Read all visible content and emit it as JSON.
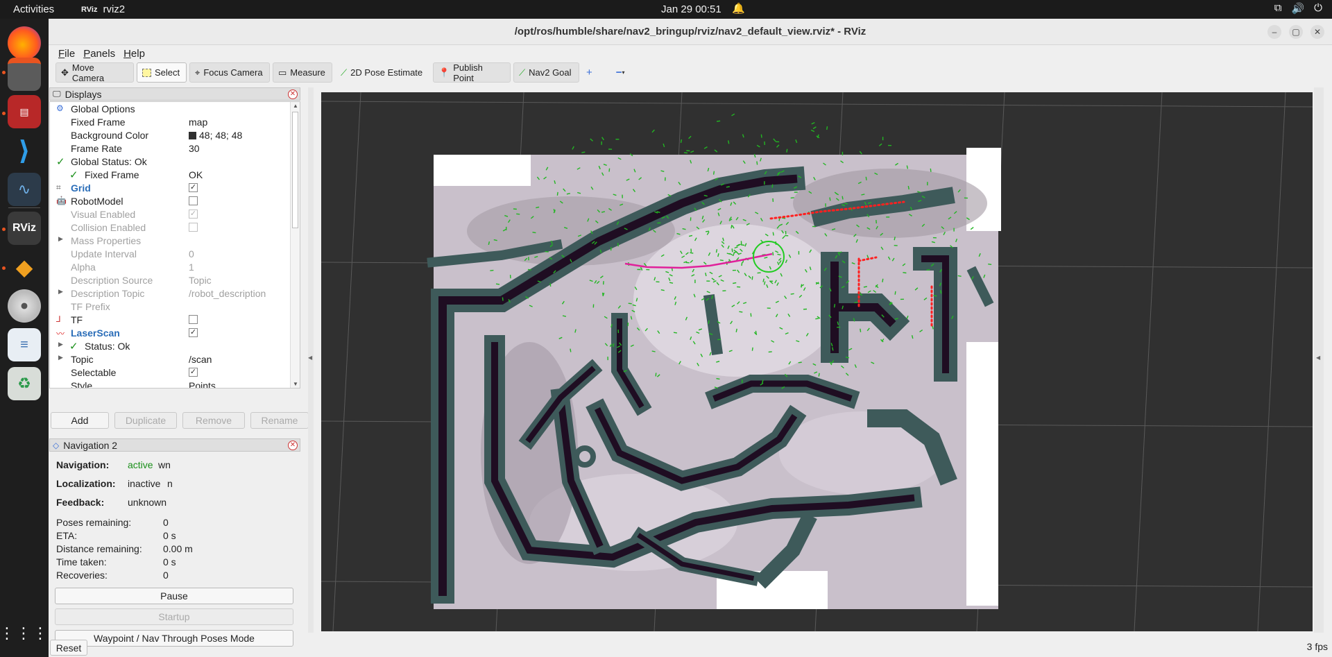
{
  "topbar": {
    "activities": "Activities",
    "app_name": "rviz2",
    "clock": "Jan 29  00:51"
  },
  "dock": {
    "items": [
      {
        "name": "firefox-icon"
      },
      {
        "name": "files-icon"
      },
      {
        "name": "terminal-icon"
      },
      {
        "name": "vscode-icon"
      },
      {
        "name": "system-monitor-icon"
      },
      {
        "name": "rviz-icon"
      },
      {
        "name": "gazebo-icon"
      },
      {
        "name": "disc-icon"
      },
      {
        "name": "text-editor-icon"
      },
      {
        "name": "trash-icon"
      },
      {
        "name": "show-apps-icon"
      }
    ]
  },
  "window": {
    "title": "/opt/ros/humble/share/nav2_bringup/rviz/nav2_default_view.rviz* - RViz"
  },
  "menu": [
    "File",
    "Panels",
    "Help"
  ],
  "toolbar": {
    "move_camera": "Move Camera",
    "select": "Select",
    "focus_camera": "Focus Camera",
    "measure": "Measure",
    "pose_estimate": "2D Pose Estimate",
    "publish_point": "Publish Point",
    "nav2_goal": "Nav2 Goal",
    "add": "+",
    "remove": "−"
  },
  "displays": {
    "title": "Displays",
    "rows": {
      "global_options": "Global Options",
      "fixed_frame_k": "Fixed Frame",
      "fixed_frame_v": "map",
      "bg_color_k": "Background Color",
      "bg_color_v": "48; 48; 48",
      "frame_rate_k": "Frame Rate",
      "frame_rate_v": "30",
      "global_status_k": "Global Status: Ok",
      "ff_status_k": "Fixed Frame",
      "ff_status_v": "OK",
      "grid_k": "Grid",
      "robot_model_k": "RobotModel",
      "visual_enabled_k": "Visual Enabled",
      "collision_enabled_k": "Collision Enabled",
      "mass_props_k": "Mass Properties",
      "update_interval_k": "Update Interval",
      "update_interval_v": "0",
      "alpha_k": "Alpha",
      "alpha_v": "1",
      "desc_source_k": "Description Source",
      "desc_source_v": "Topic",
      "desc_topic_k": "Description Topic",
      "desc_topic_v": "/robot_description",
      "tf_prefix_k": "TF Prefix",
      "tf_k": "TF",
      "laserscan_k": "LaserScan",
      "ls_status_k": "Status: Ok",
      "topic_k": "Topic",
      "topic_v": "/scan",
      "selectable_k": "Selectable",
      "style_k": "Style",
      "style_v": "Points"
    },
    "buttons": {
      "add": "Add",
      "duplicate": "Duplicate",
      "remove": "Remove",
      "rename": "Rename"
    }
  },
  "nav2": {
    "title": "Navigation 2",
    "navigation_k": "Navigation:",
    "navigation_v": "active",
    "navigation_suffix": "wn",
    "localization_k": "Localization:",
    "localization_v": "inactive",
    "localization_suffix": "n",
    "feedback_k": "Feedback:",
    "feedback_v": "unknown",
    "poses_k": "Poses remaining:",
    "poses_v": "0",
    "eta_k": "ETA:",
    "eta_v": "0 s",
    "distance_k": "Distance remaining:",
    "distance_v": "0.00 m",
    "time_k": "Time taken:",
    "time_v": "0 s",
    "recoveries_k": "Recoveries:",
    "recoveries_v": "0",
    "pause": "Pause",
    "startup": "Startup",
    "waypoint_mode": "Waypoint / Nav Through Poses Mode"
  },
  "footer": {
    "reset": "Reset",
    "fps": "3 fps"
  },
  "colors": {
    "viewport_bg": "#303030",
    "costmap_dark": "#1f0d22",
    "costmap_teal": "#3e5a5a",
    "costmap_light": "#c9c0cb",
    "path": "#e0209a",
    "laser": "#ff2020",
    "particles": "#22b622"
  }
}
